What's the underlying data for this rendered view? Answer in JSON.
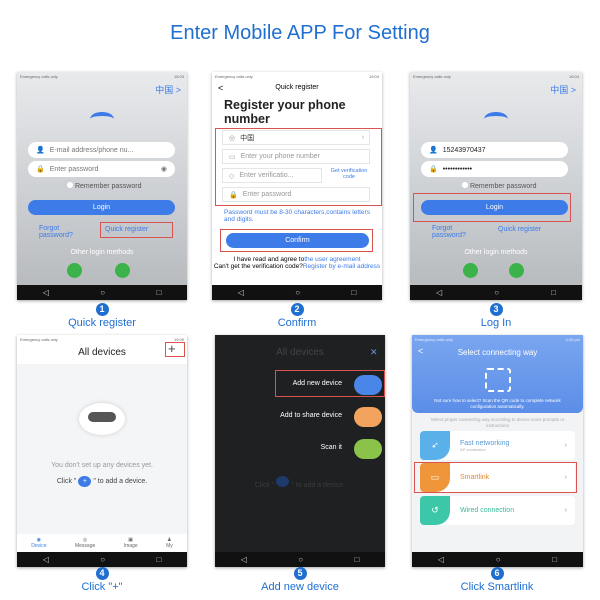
{
  "title": "Enter Mobile APP For Setting",
  "colors": {
    "accent": "#1f6fd1",
    "button": "#3d7be8",
    "highlight": "#d9534f"
  },
  "status": {
    "carrier": "Emergency calls only",
    "time1": "15:03",
    "time2": "19:04",
    "time3": "19:04",
    "time4": "19:05",
    "time6": "4:26 pm"
  },
  "nav": {
    "back": "◁",
    "home": "○",
    "recent": "□"
  },
  "steps": [
    {
      "num": "1",
      "label": "Quick register"
    },
    {
      "num": "2",
      "label": "Confirm"
    },
    {
      "num": "3",
      "label": "Log In"
    },
    {
      "num": "4",
      "label": "Click \"+\""
    },
    {
      "num": "5",
      "label": "Add new device"
    },
    {
      "num": "6",
      "label": "Click Smartlink"
    }
  ],
  "login": {
    "region": "中国 >",
    "email_placeholder": "E-mail address/phone nu...",
    "password_placeholder": "Enter password",
    "remember": "Remember password",
    "login_btn": "Login",
    "forgot": "Forgot password?",
    "quick_register": "Quick register",
    "other": "Other login methods",
    "phone_value": "15243970437",
    "password_value": "••••••••••••"
  },
  "register": {
    "header": "Quick register",
    "back": "<",
    "heading": "Register your phone number",
    "country": "中国",
    "phone_placeholder": "Enter your phone number",
    "code_placeholder": "Enter verificatio...",
    "get_code": "Get verification code",
    "password_placeholder": "Enter password",
    "hint": "Password must be 8-30 characters,contains letters and digits.",
    "confirm": "Confirm",
    "agree": "I have read and agree to",
    "agree_link": "the user agreement",
    "cant_get": "Can't get the verification code?",
    "email_link": "Register by e-mail address"
  },
  "devices": {
    "header": "All devices",
    "add": "+",
    "empty": "You don't set up any devices yet.",
    "click_pre": "Click \"",
    "click_post": "\" to add a device.",
    "tabs": [
      "Device",
      "Message",
      "Image",
      "My"
    ]
  },
  "addmenu": {
    "close": "✕",
    "items": [
      {
        "label": "Add new device",
        "icon": "wifi-signal-icon",
        "color": "#4a86e8"
      },
      {
        "label": "Add to share device",
        "icon": "link-icon",
        "color": "#f2a35e"
      },
      {
        "label": "Scan it",
        "icon": "scan-icon",
        "color": "#8bc34a"
      }
    ]
  },
  "connect": {
    "back": "<",
    "header": "Select connecting way",
    "qr_hint": "Not sure how to select? Scan the QR code to complete network configuration automatically.",
    "instruction": "Select proper connecting way according to device voice prompts or instructions",
    "options": [
      {
        "label": "Fast networking",
        "sub": "AP connection",
        "color": "#5ab0e8",
        "text_color": "#5a9bd5"
      },
      {
        "label": "Smartlink",
        "sub": "",
        "color": "#f0963a",
        "text_color": "#e08a2e"
      },
      {
        "label": "Wired connection",
        "sub": "",
        "color": "#3cc8a8",
        "text_color": "#3cb89a"
      }
    ]
  }
}
